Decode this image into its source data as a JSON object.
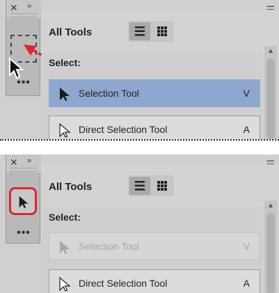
{
  "panel": {
    "close_glyph": "✕",
    "expand_glyph": "››",
    "more_glyph": "•••",
    "menu_glyph": "☰",
    "title": "All Tools",
    "section_label": "Select:",
    "tools": [
      {
        "label": "Selection Tool",
        "shortcut": "V"
      },
      {
        "label": "Direct Selection Tool",
        "shortcut": "A"
      }
    ]
  },
  "colors": {
    "selected_row": "#8ea7cf",
    "highlight_ring": "#e0252b",
    "drag_arrow": "#e0252b"
  },
  "icons": [
    "close-icon",
    "expand-icon",
    "list-view-icon",
    "grid-view-icon",
    "panel-menu-icon",
    "selection-tool-icon",
    "direct-selection-tool-icon",
    "more-icon",
    "mouse-cursor-icon"
  ]
}
